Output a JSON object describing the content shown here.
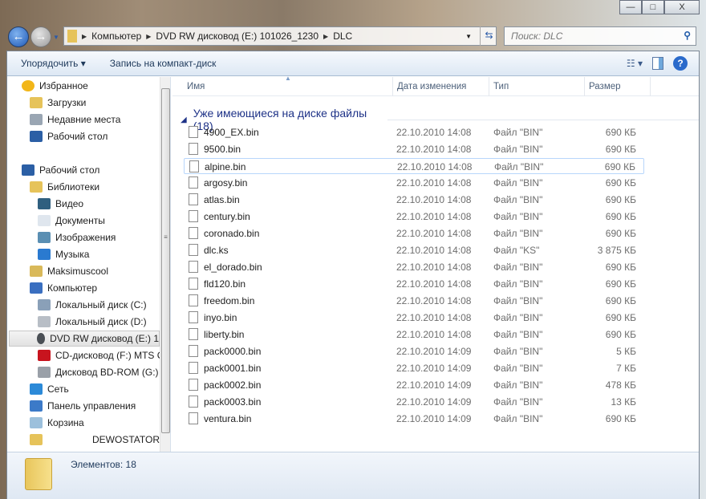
{
  "window": {
    "controls": [
      "—",
      "□",
      "X"
    ]
  },
  "address": {
    "segments": [
      "Компьютер",
      "DVD RW дисковод (E:) 101026_1230",
      "DLC"
    ]
  },
  "search": {
    "placeholder": "Поиск: DLC"
  },
  "toolbar": {
    "organize": "Упорядочить ▾",
    "burn": "Запись на компакт-диск"
  },
  "sidebar": {
    "items": [
      {
        "label": "Избранное",
        "icon": "star-icon",
        "color": "#f2b619",
        "indent": 0
      },
      {
        "label": "Загрузки",
        "icon": "downloads-icon",
        "color": "#e6c35a",
        "indent": 1
      },
      {
        "label": "Недавние места",
        "icon": "recent-places-icon",
        "color": "#9aa6b3",
        "indent": 1
      },
      {
        "label": "Рабочий стол",
        "icon": "desktop-icon",
        "color": "#2b5fa5",
        "indent": 1
      },
      {
        "label": "Рабочий стол",
        "icon": "desktop-icon",
        "color": "#2b5fa5",
        "indent": 0
      },
      {
        "label": "Библиотеки",
        "icon": "libraries-icon",
        "color": "#e6c35a",
        "indent": 1
      },
      {
        "label": "Видео",
        "icon": "video-icon",
        "color": "#2f5f7f",
        "indent": 2
      },
      {
        "label": "Документы",
        "icon": "documents-icon",
        "color": "#dfe6ee",
        "indent": 2
      },
      {
        "label": "Изображения",
        "icon": "pictures-icon",
        "color": "#5a8fb3",
        "indent": 2
      },
      {
        "label": "Музыка",
        "icon": "music-icon",
        "color": "#2a7ad0",
        "indent": 2
      },
      {
        "label": "Maksimuscool",
        "icon": "user-folder-icon",
        "color": "#d9b95a",
        "indent": 1
      },
      {
        "label": "Компьютер",
        "icon": "computer-icon",
        "color": "#3a6fc0",
        "indent": 1
      },
      {
        "label": "Локальный диск (C:)",
        "icon": "drive-icon",
        "color": "#8aa0b8",
        "indent": 2
      },
      {
        "label": "Локальный диск (D:)",
        "icon": "drive-icon",
        "color": "#b8bec6",
        "indent": 2
      },
      {
        "label": "DVD RW дисковод (E:) 1",
        "icon": "dvd-icon",
        "color": "#4a4f55",
        "indent": 2,
        "selected": true
      },
      {
        "label": "CD-дисковод (F:) MTS C",
        "icon": "cd-icon",
        "color": "#c8141e",
        "indent": 2
      },
      {
        "label": "Дисковод BD-ROM (G:)",
        "icon": "bd-rom-icon",
        "color": "#9aa0a8",
        "indent": 2
      },
      {
        "label": "Сеть",
        "icon": "network-icon",
        "color": "#2c8ad8",
        "indent": 1
      },
      {
        "label": "Панель управления",
        "icon": "control-panel-icon",
        "color": "#3c7ac8",
        "indent": 1
      },
      {
        "label": "Корзина",
        "icon": "recycle-bin-icon",
        "color": "#9cc0dc",
        "indent": 1
      },
      {
        "label": "DEWOSTATOR",
        "icon": "folder-icon",
        "color": "#e6c35a",
        "indent": 1
      }
    ]
  },
  "columns": {
    "name": "Имя",
    "date": "Дата изменения",
    "type": "Тип",
    "size": "Размер"
  },
  "group": {
    "title": "Уже имеющиеся на диске файлы (18)"
  },
  "files": [
    {
      "name": "4900_EX.bin",
      "date": "22.10.2010 14:08",
      "type": "Файл \"BIN\"",
      "size": "690 КБ"
    },
    {
      "name": "9500.bin",
      "date": "22.10.2010 14:08",
      "type": "Файл \"BIN\"",
      "size": "690 КБ"
    },
    {
      "name": "alpine.bin",
      "date": "22.10.2010 14:08",
      "type": "Файл \"BIN\"",
      "size": "690 КБ"
    },
    {
      "name": "argosy.bin",
      "date": "22.10.2010 14:08",
      "type": "Файл \"BIN\"",
      "size": "690 КБ"
    },
    {
      "name": "atlas.bin",
      "date": "22.10.2010 14:08",
      "type": "Файл \"BIN\"",
      "size": "690 КБ"
    },
    {
      "name": "century.bin",
      "date": "22.10.2010 14:08",
      "type": "Файл \"BIN\"",
      "size": "690 КБ"
    },
    {
      "name": "coronado.bin",
      "date": "22.10.2010 14:08",
      "type": "Файл \"BIN\"",
      "size": "690 КБ"
    },
    {
      "name": "dlc.ks",
      "date": "22.10.2010 14:08",
      "type": "Файл \"KS\"",
      "size": "3 875 КБ"
    },
    {
      "name": "el_dorado.bin",
      "date": "22.10.2010 14:08",
      "type": "Файл \"BIN\"",
      "size": "690 КБ"
    },
    {
      "name": "fld120.bin",
      "date": "22.10.2010 14:08",
      "type": "Файл \"BIN\"",
      "size": "690 КБ"
    },
    {
      "name": "freedom.bin",
      "date": "22.10.2010 14:08",
      "type": "Файл \"BIN\"",
      "size": "690 КБ"
    },
    {
      "name": "inyo.bin",
      "date": "22.10.2010 14:08",
      "type": "Файл \"BIN\"",
      "size": "690 КБ"
    },
    {
      "name": "liberty.bin",
      "date": "22.10.2010 14:08",
      "type": "Файл \"BIN\"",
      "size": "690 КБ"
    },
    {
      "name": "pack0000.bin",
      "date": "22.10.2010 14:09",
      "type": "Файл \"BIN\"",
      "size": "5 КБ"
    },
    {
      "name": "pack0001.bin",
      "date": "22.10.2010 14:09",
      "type": "Файл \"BIN\"",
      "size": "7 КБ"
    },
    {
      "name": "pack0002.bin",
      "date": "22.10.2010 14:09",
      "type": "Файл \"BIN\"",
      "size": "478 КБ"
    },
    {
      "name": "pack0003.bin",
      "date": "22.10.2010 14:09",
      "type": "Файл \"BIN\"",
      "size": "13 КБ"
    },
    {
      "name": "ventura.bin",
      "date": "22.10.2010 14:09",
      "type": "Файл \"BIN\"",
      "size": "690 КБ"
    }
  ],
  "hover_index": 2,
  "status": {
    "count": "Элементов: 18"
  }
}
